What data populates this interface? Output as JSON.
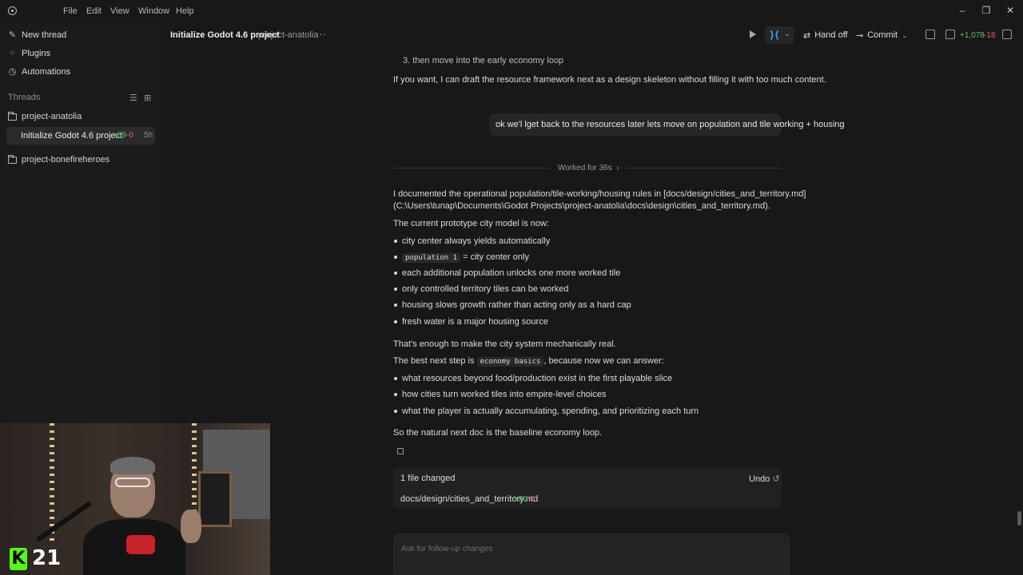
{
  "menu": [
    "File",
    "Edit",
    "View",
    "Window",
    "Help"
  ],
  "window_controls": {
    "minimize": "–",
    "restore": "❐",
    "close": "✕"
  },
  "sidebar": {
    "new_thread": "New thread",
    "plugins": "Plugins",
    "automations": "Automations",
    "threads_header": "Threads",
    "projects": [
      {
        "name": "project-anatolia",
        "threads": [
          {
            "title": "Initialize Godot 4.6 project",
            "plus": "+89",
            "minus": "-0",
            "age": "5h"
          }
        ]
      },
      {
        "name": "project-bonefireheroes",
        "threads": []
      }
    ]
  },
  "header": {
    "title": "Initialize Godot 4.6 project",
    "project": "project-anatolia",
    "more": "···",
    "hand_off": "Hand off",
    "commit": "Commit",
    "diff_plus": "+1,078",
    "diff_minus": "-18"
  },
  "chat": {
    "prev_item": "3. then move into the early economy loop",
    "prev_para": "If you want, I can draft the resource framework next as a design skeleton without filling it with too much content.",
    "user_message": "ok we'l lget back to the resources later lets move on population and tile working + housing",
    "worked_for": "Worked for 36s",
    "doc_line1": "I documented the operational population/tile-working/housing rules in [docs/design/cities_and_territory.md]",
    "doc_line2": "(C:\\Users\\tunap\\Documents\\Godot Projects\\project-anatolia\\docs\\design\\cities_and_territory.md).",
    "model_intro": "The current prototype city model is now:",
    "bullets1": [
      "city center always yields automatically",
      "= city center only",
      "each additional population unlocks one more worked tile",
      "only controlled territory tiles can be worked",
      "housing slows growth rather than acting only as a hard cap",
      "fresh water is a major housing source"
    ],
    "code_population": "population 1",
    "enough": "That’s enough to make the city system mechanically real.",
    "next_step_a": "The best next step is",
    "code_economy": "economy basics",
    "next_step_b": ", because now we can answer:",
    "bullets2": [
      "what resources beyond food/production exist in the first playable slice",
      "how cities turn worked tiles into empire-level choices",
      "what the player is actually accumulating, spending, and prioritizing each turn"
    ],
    "conclusion": "So the natural next doc is the baseline economy loop."
  },
  "files_changed": {
    "title": "1 file changed",
    "undo": "Undo",
    "file": "docs/design/cities_and_territory.md",
    "plus": "+89",
    "minus": "-0"
  },
  "composer": {
    "placeholder": "Ask for follow-up changes"
  },
  "webcam": {
    "badge_letter": "K",
    "badge_number": "21"
  },
  "colors": {
    "add": "#5cc15c",
    "remove": "#e06060",
    "kick_green": "#53fc18"
  }
}
